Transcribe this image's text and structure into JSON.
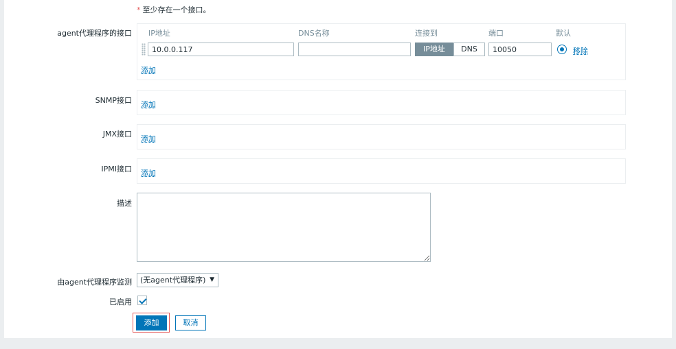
{
  "note": {
    "star": "*",
    "text": "至少存在一个接口。"
  },
  "agent": {
    "label": "agent代理程序的接口",
    "headers": {
      "ip": "IP地址",
      "dns": "DNS名称",
      "connect": "连接到",
      "port": "端口",
      "default": "默认"
    },
    "row": {
      "ip": "10.0.0.117",
      "dns": "",
      "connect_ip": "IP地址",
      "connect_dns": "DNS",
      "port": "10050",
      "remove": "移除"
    },
    "add": "添加"
  },
  "snmp": {
    "label": "SNMP接口",
    "add": "添加"
  },
  "jmx": {
    "label": "JMX接口",
    "add": "添加"
  },
  "ipmi": {
    "label": "IPMI接口",
    "add": "添加"
  },
  "description": {
    "label": "描述",
    "value": ""
  },
  "monitored_by": {
    "label": "由agent代理程序监测",
    "value": "(无agent代理程序)"
  },
  "enabled": {
    "label": "已启用",
    "checked": true
  },
  "buttons": {
    "add": "添加",
    "cancel": "取消"
  },
  "colors": {
    "accent": "#0275b8",
    "highlight": "#e45959",
    "muted": "#768d99"
  }
}
